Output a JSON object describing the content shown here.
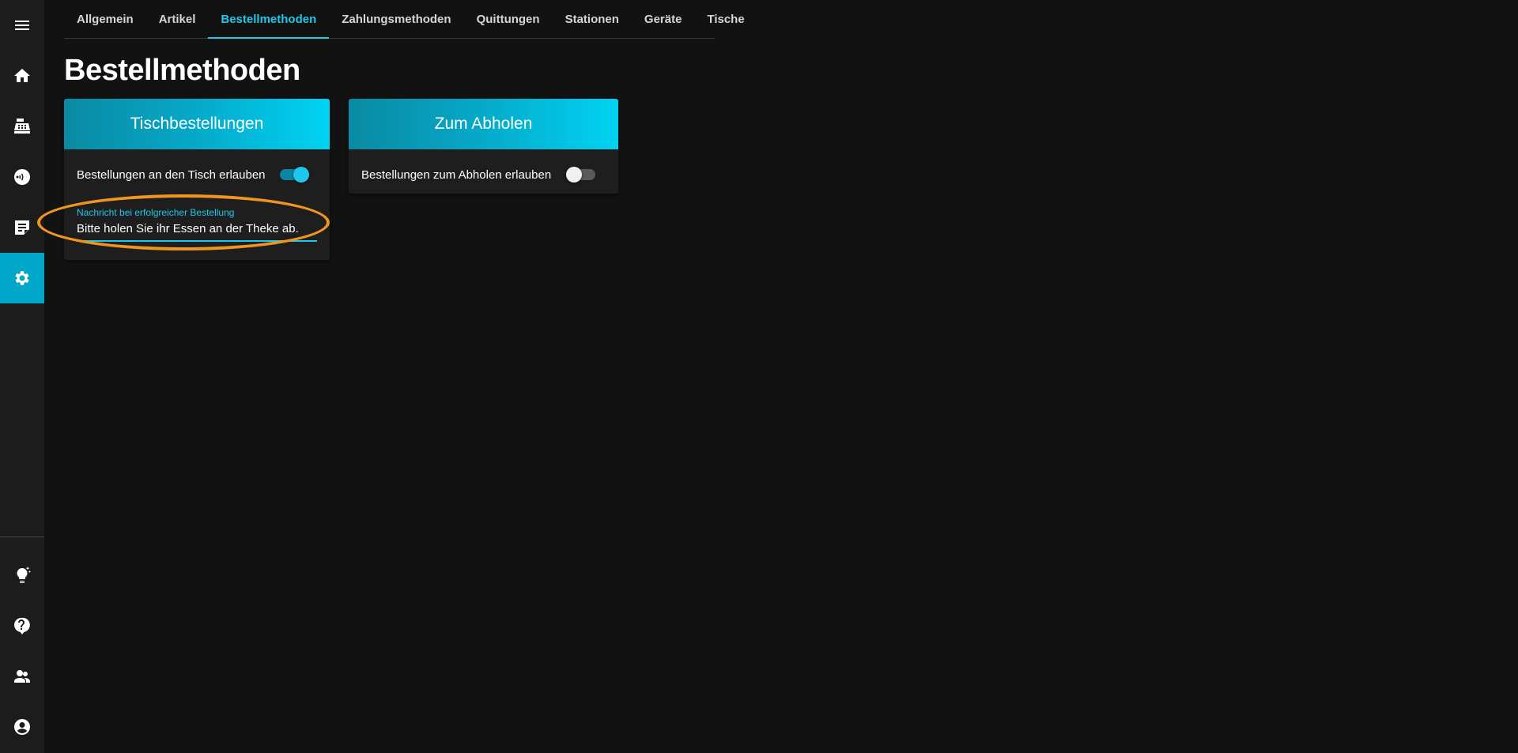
{
  "sidebar": {
    "items": [
      {
        "name": "menu",
        "icon": "menu-icon"
      },
      {
        "name": "home",
        "icon": "home-icon"
      },
      {
        "name": "cash-register",
        "icon": "cash-register-icon"
      },
      {
        "name": "nfc",
        "icon": "nfc-icon"
      },
      {
        "name": "orders",
        "icon": "note-icon"
      },
      {
        "name": "settings",
        "icon": "gear-icon",
        "active": true
      }
    ],
    "bottom_items": [
      {
        "name": "ideas",
        "icon": "lightbulb-icon"
      },
      {
        "name": "help",
        "icon": "help-icon"
      },
      {
        "name": "users",
        "icon": "users-icon"
      },
      {
        "name": "account",
        "icon": "account-icon"
      }
    ]
  },
  "tabs": [
    {
      "label": "Allgemein"
    },
    {
      "label": "Artikel"
    },
    {
      "label": "Bestellmethoden",
      "active": true
    },
    {
      "label": "Zahlungsmethoden"
    },
    {
      "label": "Quittungen"
    },
    {
      "label": "Stationen"
    },
    {
      "label": "Geräte"
    },
    {
      "label": "Tische"
    }
  ],
  "page": {
    "title": "Bestellmethoden"
  },
  "cards": {
    "table": {
      "title": "Tischbestellungen",
      "toggle_label": "Bestellungen an den Tisch erlauben",
      "toggle_on": true,
      "message_label": "Nachricht bei erfolgreicher Bestellung",
      "message_value": "Bitte holen Sie ihr Essen an der Theke ab."
    },
    "pickup": {
      "title": "Zum Abholen",
      "toggle_label": "Bestellungen zum Abholen erlauben",
      "toggle_on": false
    }
  },
  "colors": {
    "accent": "#1ec8ec",
    "active_sidebar": "#00a7c9",
    "highlight": "#f0961e",
    "background": "#121212"
  }
}
